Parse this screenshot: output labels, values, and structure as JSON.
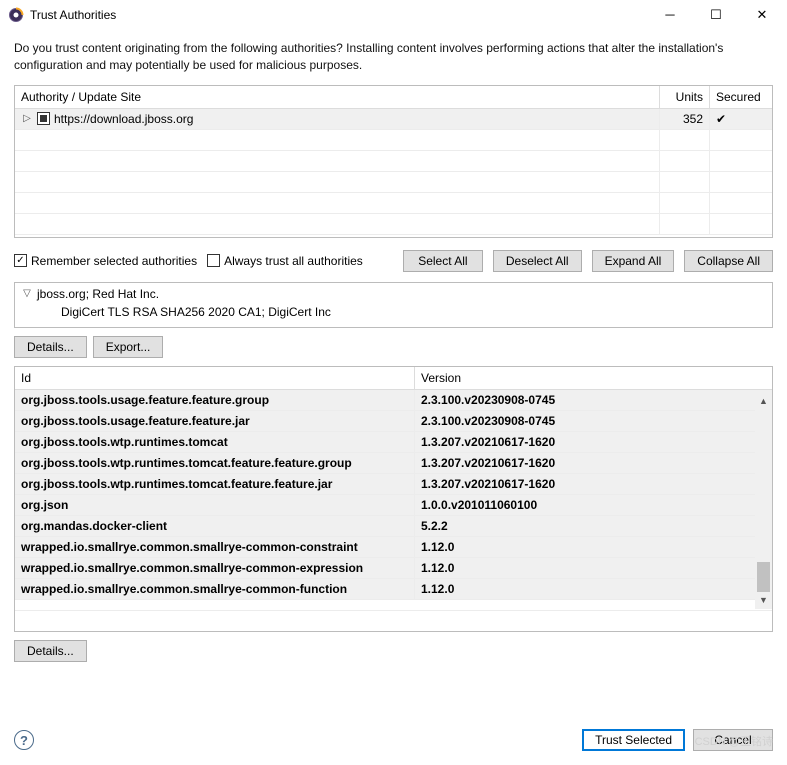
{
  "title": "Trust Authorities",
  "intro": "Do you trust content originating from the following authorities?  Installing content involves performing actions that alter the installation's configuration and may potentially be used for malicious purposes.",
  "authTable": {
    "headers": {
      "authority": "Authority / Update Site",
      "units": "Units",
      "secured": "Secured"
    },
    "rows": [
      {
        "url": "https://download.jboss.org",
        "units": "352",
        "secured": true,
        "checked": "filled"
      }
    ]
  },
  "options": {
    "remember": {
      "label": "Remember selected authorities",
      "checked": true
    },
    "always": {
      "label": "Always trust all authorities",
      "checked": false
    }
  },
  "buttons": {
    "selectAll": "Select All",
    "deselectAll": "Deselect All",
    "expandAll": "Expand All",
    "collapseAll": "Collapse All",
    "details": "Details...",
    "export": "Export...",
    "trustSelected": "Trust Selected",
    "cancel": "Cancel"
  },
  "cert": {
    "line1": "jboss.org; Red Hat Inc.",
    "line2": "DigiCert TLS RSA SHA256 2020 CA1; DigiCert Inc"
  },
  "resTable": {
    "headers": {
      "id": "Id",
      "version": "Version"
    },
    "rows": [
      {
        "id": "org.jboss.tools.usage.feature.feature.group",
        "version": "2.3.100.v20230908-0745"
      },
      {
        "id": "org.jboss.tools.usage.feature.feature.jar",
        "version": "2.3.100.v20230908-0745"
      },
      {
        "id": "org.jboss.tools.wtp.runtimes.tomcat",
        "version": "1.3.207.v20210617-1620"
      },
      {
        "id": "org.jboss.tools.wtp.runtimes.tomcat.feature.feature.group",
        "version": "1.3.207.v20210617-1620"
      },
      {
        "id": "org.jboss.tools.wtp.runtimes.tomcat.feature.feature.jar",
        "version": "1.3.207.v20210617-1620"
      },
      {
        "id": "org.json",
        "version": "1.0.0.v201011060100"
      },
      {
        "id": "org.mandas.docker-client",
        "version": "5.2.2"
      },
      {
        "id": "wrapped.io.smallrye.common.smallrye-common-constraint",
        "version": "1.12.0"
      },
      {
        "id": "wrapped.io.smallrye.common.smallrye-common-expression",
        "version": "1.12.0"
      },
      {
        "id": "wrapped.io.smallrye.common.smallrye-common-function",
        "version": "1.12.0"
      }
    ]
  },
  "watermark": "CSDN @王铭诗"
}
